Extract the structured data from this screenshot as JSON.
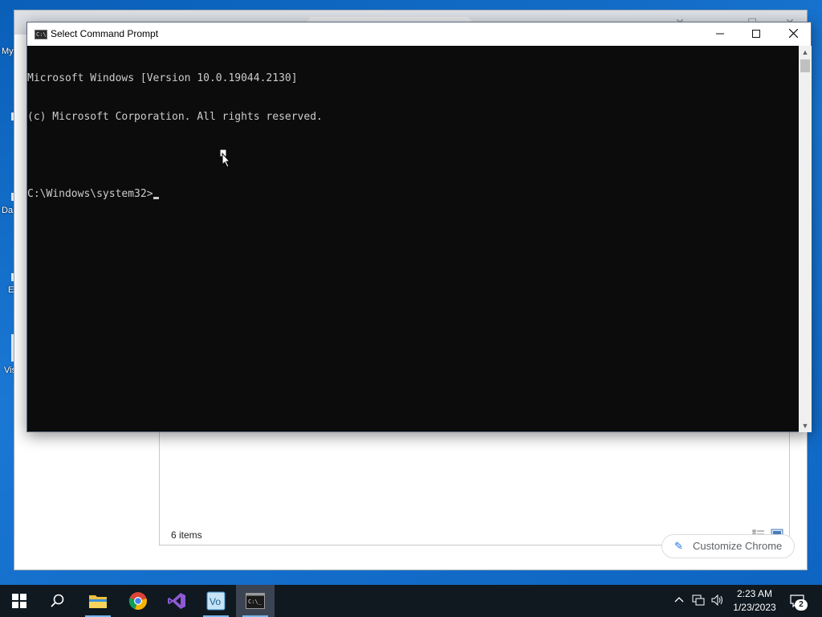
{
  "desktop": {
    "icon_fragments": [
      "My",
      "Da",
      "E",
      "Vis"
    ]
  },
  "chrome": {
    "customize_label": "Customize Chrome"
  },
  "explorer": {
    "status_items": "6 items"
  },
  "cmd": {
    "title": "Select Command Prompt",
    "lines": [
      "Microsoft Windows [Version 10.0.19044.2130]",
      "(c) Microsoft Corporation. All rights reserved.",
      "",
      "C:\\Windows\\system32>"
    ]
  },
  "taskbar": {
    "apps": [
      "start-icon",
      "search-icon",
      "file-explorer-icon",
      "chrome-icon",
      "visual-studio-icon",
      "vmware-icon",
      "command-prompt-icon"
    ],
    "active_app": "command-prompt-icon",
    "tray": {
      "time": "2:23 AM",
      "date": "1/23/2023",
      "notification_count": "2"
    }
  },
  "colors": {
    "desktop_bg": "#1a78d4",
    "console_bg": "#0c0c0c",
    "console_fg": "#cccccc",
    "taskbar_bg": "#101820",
    "taskbar_accent": "#76b9ed"
  }
}
